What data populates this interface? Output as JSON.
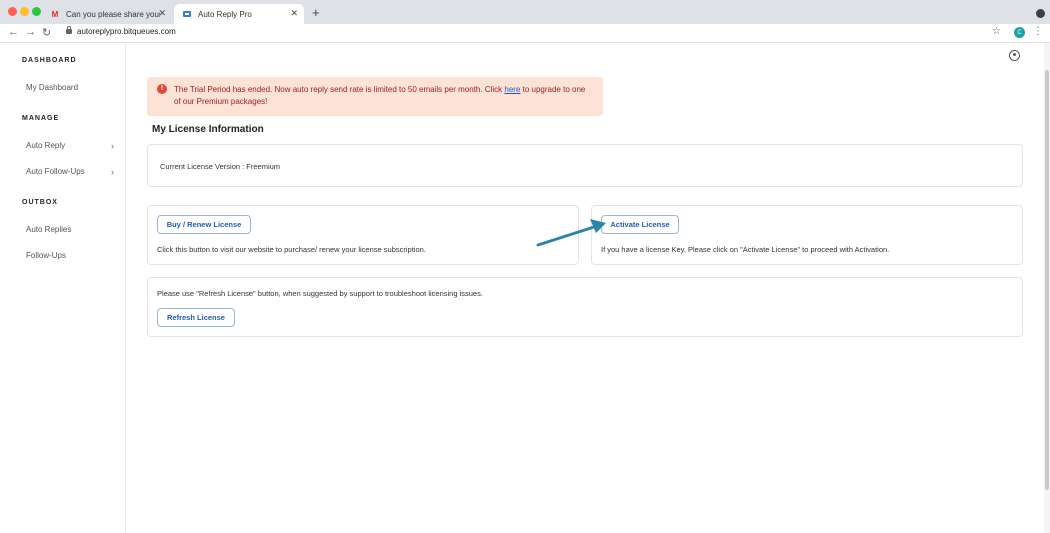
{
  "browser": {
    "tabs": [
      {
        "title": "Can you please share your me...",
        "favicon": "gmail-icon",
        "active": false
      },
      {
        "title": "Auto Reply Pro",
        "favicon": "app-icon",
        "active": true
      }
    ],
    "new_tab": "+",
    "url": "autoreplypro.bitqueues.com",
    "profile_initial": "C"
  },
  "sidebar": {
    "sections": [
      {
        "heading": "DASHBOARD",
        "items": [
          {
            "label": "My Dashboard"
          }
        ]
      },
      {
        "heading": "MANAGE",
        "items": [
          {
            "label": "Auto Reply",
            "chevron": true
          },
          {
            "label": "Auto Follow-Ups",
            "chevron": true
          }
        ]
      },
      {
        "heading": "OUTBOX",
        "items": [
          {
            "label": "Auto Replies"
          },
          {
            "label": "Follow-Ups"
          }
        ]
      }
    ]
  },
  "alert": {
    "text_before": "The Trial Period has ended. Now auto reply send rate is limited to 50 emails per month. Click ",
    "link": "here",
    "text_after": " to upgrade to one of our Premium packages!",
    "color": "#fde3d6"
  },
  "page_title": "My License Information",
  "license": {
    "current": "Current License Version : Freemium"
  },
  "buy": {
    "button": "Buy / Renew License",
    "description": "Click this button to visit our website to purchase/ renew your license subscription."
  },
  "activate": {
    "button": "Activate License",
    "description": "If you have a license Key, Please click on \"Activate License\" to proceed with Activation."
  },
  "refresh": {
    "description": "Please use \"Refresh License\" button, when suggested by support to troubleshoot licensing issues.",
    "button": "Refresh License"
  },
  "annotation": {
    "color": "#2a86a8",
    "icon": "arrow-annotation"
  }
}
